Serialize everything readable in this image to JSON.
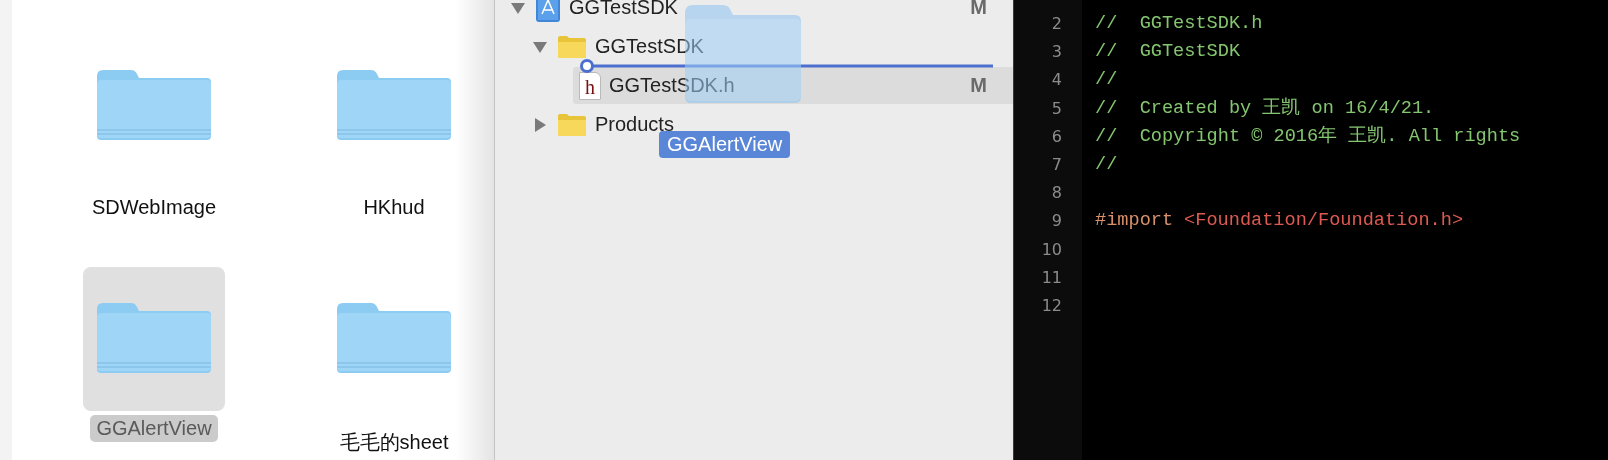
{
  "finder": {
    "items": [
      {
        "name": "SDWebImage",
        "selected": false
      },
      {
        "name": "HKhud",
        "selected": false
      },
      {
        "name": "GGAlertView",
        "selected": true
      },
      {
        "name": "毛毛的sheet",
        "selected": false
      }
    ]
  },
  "navigator": {
    "rows": [
      {
        "kind": "project",
        "name": "GGTestSDK",
        "badge": "M",
        "expanded": true,
        "selected": false,
        "children": [
          {
            "kind": "folder",
            "name": "GGTestSDK",
            "expanded": true,
            "selected": false,
            "children": [
              {
                "kind": "file",
                "name": "GGTestSDK.h",
                "icon_letter": "h",
                "badge": "M",
                "selected": true
              }
            ]
          },
          {
            "kind": "folder",
            "name": "Products",
            "expanded": false,
            "selected": false
          }
        ]
      }
    ],
    "drag": {
      "label": "GGAlertView"
    }
  },
  "editor": {
    "lines": [
      {
        "number": "2",
        "tokens": [
          {
            "kind": "comment",
            "text": "//  GGTestSDK.h"
          }
        ]
      },
      {
        "number": "3",
        "tokens": [
          {
            "kind": "comment",
            "text": "//  GGTestSDK"
          }
        ]
      },
      {
        "number": "4",
        "tokens": [
          {
            "kind": "comment",
            "text": "//"
          }
        ]
      },
      {
        "number": "5",
        "tokens": [
          {
            "kind": "comment",
            "text": "//  Created by 王凯 on 16/4/21."
          }
        ]
      },
      {
        "number": "6",
        "tokens": [
          {
            "kind": "comment",
            "text": "//  Copyright © 2016年 王凯. All rights"
          }
        ]
      },
      {
        "number": "7",
        "tokens": [
          {
            "kind": "comment",
            "text": "//"
          }
        ]
      },
      {
        "number": "8"
      },
      {
        "number": "9",
        "tokens": [
          {
            "kind": "keyword",
            "text": "#import"
          },
          {
            "kind": "string",
            "text": "<Foundation/Foundation.h>"
          }
        ]
      },
      {
        "number": "10"
      },
      {
        "number": "11"
      },
      {
        "number": "12"
      }
    ]
  }
}
